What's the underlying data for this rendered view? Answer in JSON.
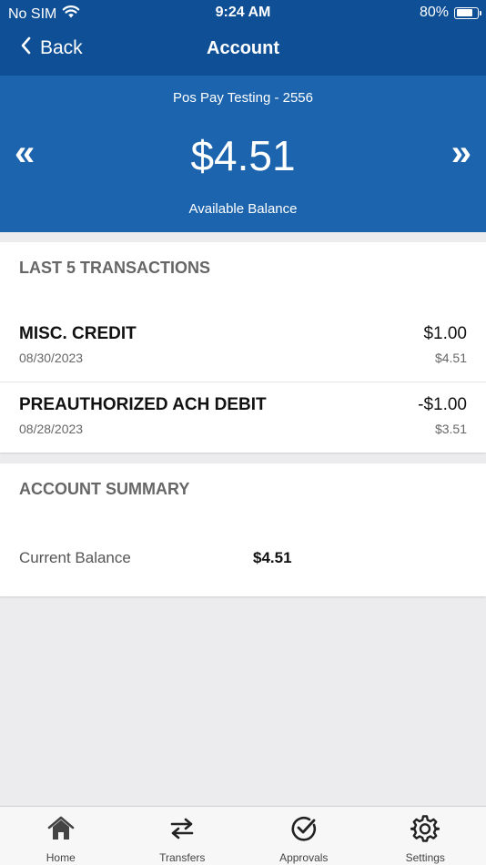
{
  "status_bar": {
    "carrier": "No SIM",
    "time": "9:24 AM",
    "battery_percent": "80%",
    "battery_level": 0.8
  },
  "nav": {
    "back_label": "Back",
    "title": "Account"
  },
  "account": {
    "name": "Pos Pay Testing - 2556",
    "balance": "$4.51",
    "balance_label": "Available Balance",
    "prev_arrow": "«",
    "next_arrow": "»"
  },
  "transactions": {
    "title": "LAST 5 TRANSACTIONS",
    "items": [
      {
        "description": "MISC. CREDIT",
        "date": "08/30/2023",
        "amount": "$1.00",
        "running_balance": "$4.51"
      },
      {
        "description": "PREAUTHORIZED ACH DEBIT",
        "date": "08/28/2023",
        "amount": "-$1.00",
        "running_balance": "$3.51"
      }
    ]
  },
  "summary": {
    "title": "ACCOUNT SUMMARY",
    "current_balance_label": "Current Balance",
    "current_balance_value": "$4.51"
  },
  "tabs": [
    {
      "label": "Home",
      "icon": "home-icon"
    },
    {
      "label": "Transfers",
      "icon": "transfer-arrows-icon"
    },
    {
      "label": "Approvals",
      "icon": "check-circle-icon"
    },
    {
      "label": "Settings",
      "icon": "gear-icon"
    }
  ],
  "colors": {
    "header_bg": "#0f4f96",
    "balance_bg": "#1c64ad",
    "page_bg": "#ececee"
  }
}
